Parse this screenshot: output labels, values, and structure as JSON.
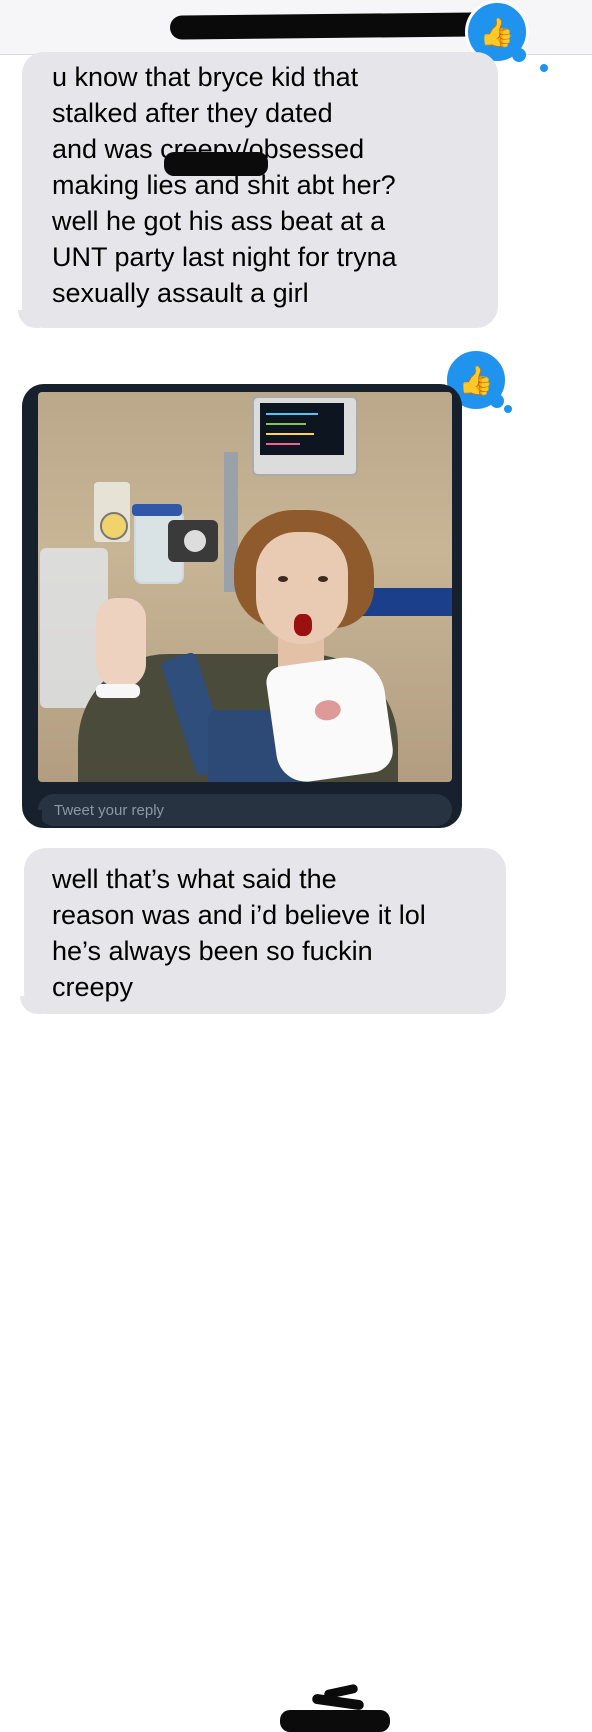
{
  "messages": [
    {
      "text": "u know that bryce kid that\nstalked              after they dated\nand was creepy/obsessed\nmaking lies and shit abt her?\nwell he got his ass beat at a\nUNT party last night for tryna\nsexually assault a girl"
    },
    {
      "tweet": {
        "reply_placeholder": "Tweet your reply"
      }
    },
    {
      "text": "well that’s what              said the\nreason was and i’d believe it lol\nhe’s always been so fuckin\ncreepy"
    }
  ],
  "tapback_icon": "thumbs-up-icon",
  "colors": {
    "bubble_bg": "#e5e5ea",
    "tapback_blue": "#1f93ee",
    "tweet_card_bg": "#17212d"
  }
}
